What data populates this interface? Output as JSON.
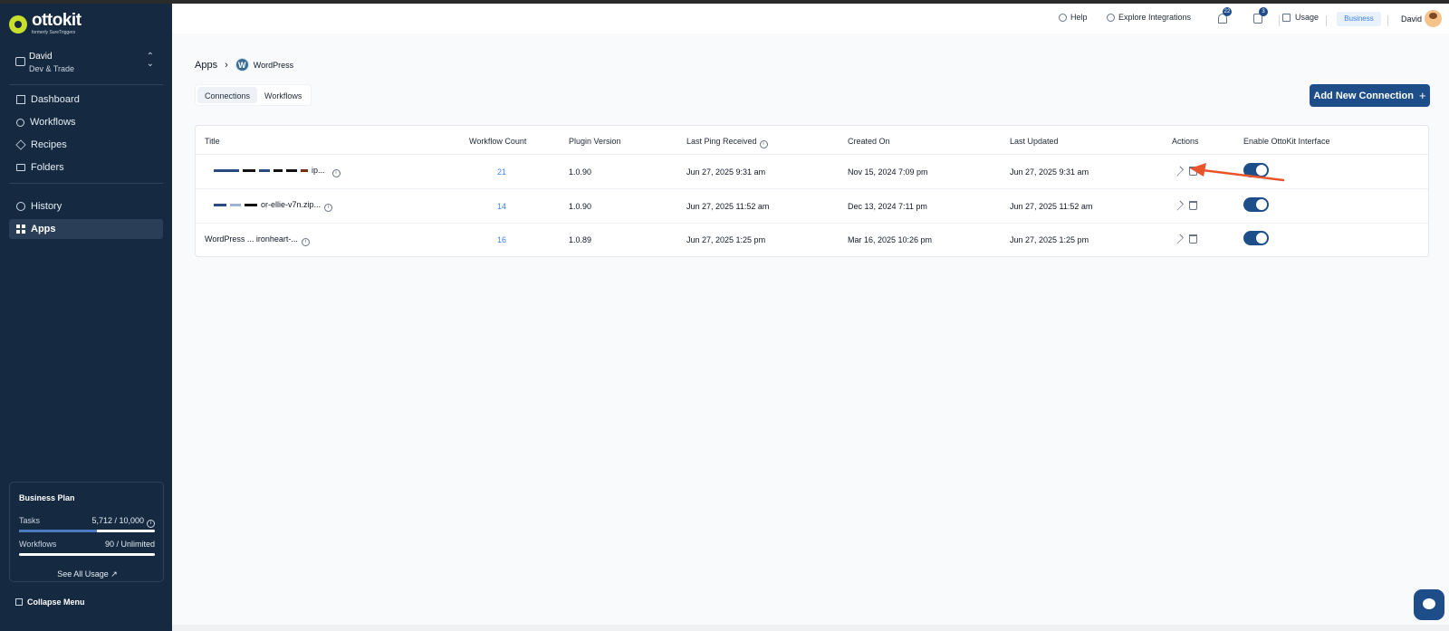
{
  "sidebar": {
    "logo": {
      "name": "ottokit",
      "sub": "formerly SureTriggers"
    },
    "workspace": {
      "name": "David",
      "sub": "Dev & Trade"
    },
    "nav": [
      {
        "label": "Dashboard",
        "icon": "home-icon"
      },
      {
        "label": "Workflows",
        "icon": "workflow-icon"
      },
      {
        "label": "Recipes",
        "icon": "layers-icon"
      },
      {
        "label": "Folders",
        "icon": "folder-icon"
      },
      {
        "label": "History",
        "icon": "history-icon"
      },
      {
        "label": "Apps",
        "icon": "apps-grid-icon",
        "active": true
      }
    ],
    "plan": {
      "title": "Business Plan",
      "tasks_label": "Tasks",
      "tasks_value": "5,712 / 10,000",
      "tasks_fraction": 0.5712,
      "workflows_label": "Workflows",
      "workflows_value": "90 / Unlimited",
      "see_usage": "See All Usage ↗"
    },
    "collapse": "Collapse Menu"
  },
  "topbar": {
    "help": "Help",
    "explore": "Explore Integrations",
    "notif_count": "22",
    "announce_count": "3",
    "usage": "Usage",
    "plan": "Business",
    "user": "David"
  },
  "main": {
    "breadcrumb": {
      "root": "Apps",
      "sep": "›",
      "app": "WordPress",
      "app_letter": "W"
    },
    "tabs": [
      {
        "label": "Connections",
        "active": true
      },
      {
        "label": "Workflows"
      }
    ],
    "add_button": "Add New Connection",
    "table": {
      "columns": [
        "Title",
        "Workflow Count",
        "Plugin Version",
        "Last Ping Received",
        "Created On",
        "Last Updated",
        "Actions",
        "Enable OttoKit Interface"
      ],
      "rows": [
        {
          "title": "ip...",
          "count": "21",
          "version": "1.0.90",
          "ping": "Jun 27, 2025 9:31 am",
          "created": "Nov 15, 2024 7:09 pm",
          "updated": "Jun 27, 2025 9:31 am",
          "enabled": true
        },
        {
          "title": "or-ellie-v7n.zip...",
          "count": "14",
          "version": "1.0.90",
          "ping": "Jun 27, 2025 11:52 am",
          "created": "Dec 13, 2024 7:11 pm",
          "updated": "Jun 27, 2025 11:52 am",
          "enabled": true
        },
        {
          "title": "WordPress ... ironheart-...",
          "count": "16",
          "version": "1.0.89",
          "ping": "Jun 27, 2025 1:25 pm",
          "created": "Mar 16, 2025 10:26 pm",
          "updated": "Jun 27, 2025 1:25 pm",
          "enabled": true
        }
      ]
    }
  },
  "colors": {
    "sidebar": "#152a40",
    "accent": "#1d4e89",
    "link": "#3b82f6",
    "arrow": "#e8542c"
  }
}
